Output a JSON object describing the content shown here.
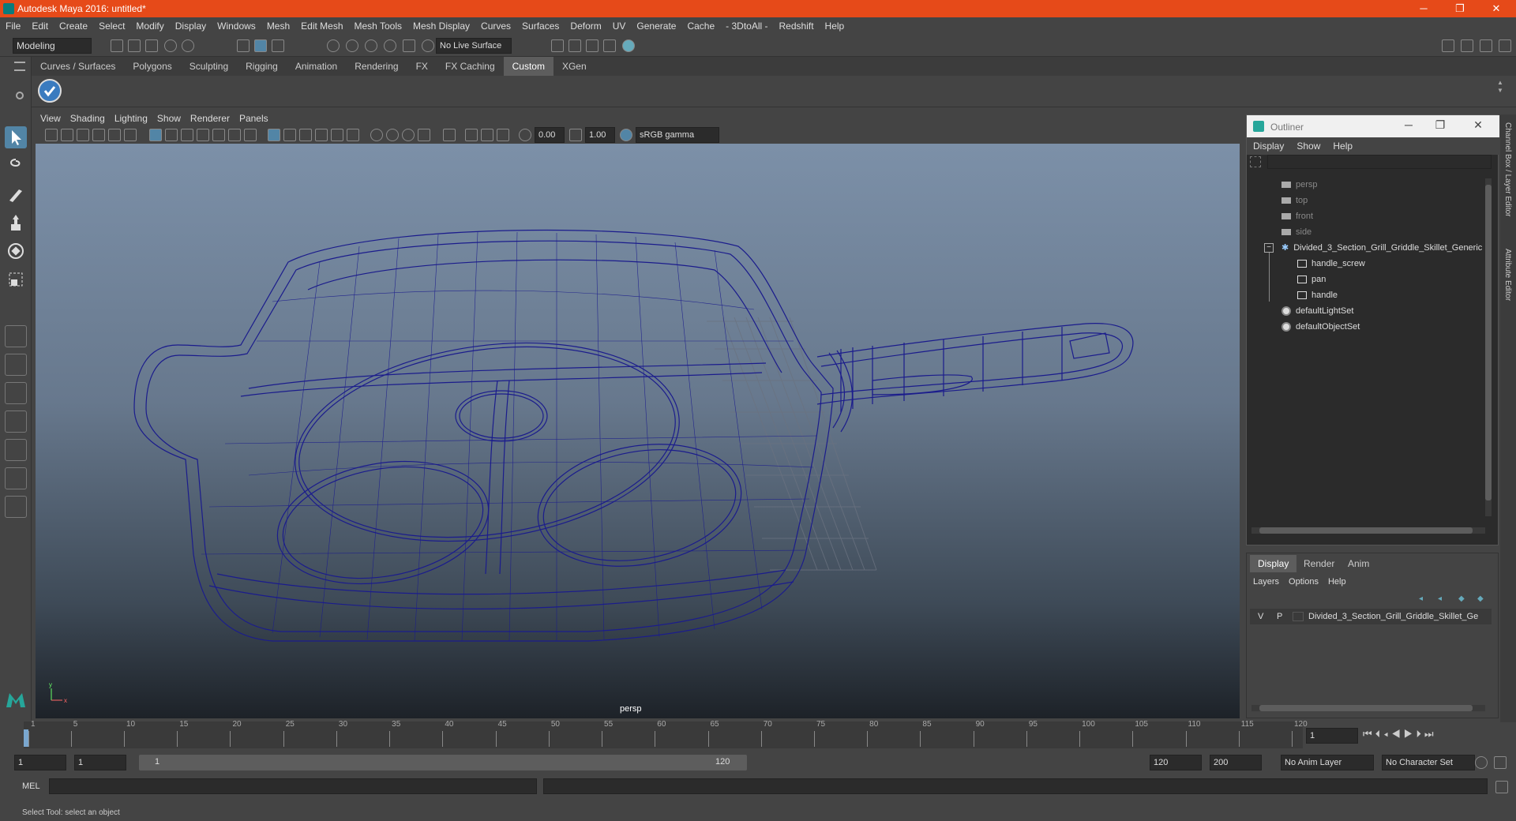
{
  "title": "Autodesk Maya 2016: untitled*",
  "window_controls": {
    "min": "─",
    "max": "❐",
    "close": "✕"
  },
  "menus": [
    "File",
    "Edit",
    "Create",
    "Select",
    "Modify",
    "Display",
    "Windows",
    "Mesh",
    "Edit Mesh",
    "Mesh Tools",
    "Mesh Display",
    "Curves",
    "Surfaces",
    "Deform",
    "UV",
    "Generate",
    "Cache",
    "- 3DtoAll -",
    "Redshift",
    "Help"
  ],
  "status": {
    "mode": "Modeling",
    "live_surface": "No Live Surface"
  },
  "shelf_tabs": [
    "Curves / Surfaces",
    "Polygons",
    "Sculpting",
    "Rigging",
    "Animation",
    "Rendering",
    "FX",
    "FX Caching",
    "Custom",
    "XGen"
  ],
  "active_shelf": "Custom",
  "viewport": {
    "menus": [
      "View",
      "Shading",
      "Lighting",
      "Show",
      "Renderer",
      "Panels"
    ],
    "exposure": "0.00",
    "gamma": "1.00",
    "color_space": "sRGB gamma",
    "camera_label": "persp"
  },
  "outliner": {
    "title": "Outliner",
    "menus": [
      "Display",
      "Show",
      "Help"
    ],
    "items": [
      {
        "label": "persp",
        "icon": "camera-icon",
        "dim": true
      },
      {
        "label": "top",
        "icon": "camera-icon",
        "dim": true
      },
      {
        "label": "front",
        "icon": "camera-icon",
        "dim": true
      },
      {
        "label": "side",
        "icon": "camera-icon",
        "dim": true
      },
      {
        "label": "Divided_3_Section_Grill_Griddle_Skillet_Generic",
        "icon": "group-icon"
      },
      {
        "label": "handle_screw",
        "icon": "mesh-icon"
      },
      {
        "label": "pan",
        "icon": "mesh-icon"
      },
      {
        "label": "handle",
        "icon": "mesh-icon"
      },
      {
        "label": "defaultLightSet",
        "icon": "set-icon"
      },
      {
        "label": "defaultObjectSet",
        "icon": "set-icon"
      }
    ]
  },
  "layer_editor": {
    "tabs": [
      "Display",
      "Render",
      "Anim"
    ],
    "active_tab": "Display",
    "menus": [
      "Layers",
      "Options",
      "Help"
    ],
    "layer": {
      "v": "V",
      "p": "P",
      "name": "Divided_3_Section_Grill_Griddle_Skillet_Ge"
    }
  },
  "side_tabs": [
    "Channel Box / Layer Editor",
    "Attribute Editor"
  ],
  "timeline": {
    "ticks": [
      "1",
      "5",
      "10",
      "15",
      "20",
      "25",
      "30",
      "35",
      "40",
      "45",
      "50",
      "55",
      "60",
      "65",
      "70",
      "75",
      "80",
      "85",
      "90",
      "95",
      "100",
      "105",
      "110",
      "115",
      "120"
    ],
    "current_frame": "1"
  },
  "range": {
    "start": "1",
    "playback_start": "1",
    "slider_start": "1",
    "slider_end": "120",
    "playback_end": "120",
    "end": "200",
    "anim_layer": "No Anim Layer",
    "character_set": "No Character Set"
  },
  "command_line": {
    "label": "MEL"
  },
  "help_line": "Select Tool: select an object",
  "colors": {
    "titlebar": "#e64a19",
    "wire": "#1b1c8c",
    "panel": "#444444",
    "field": "#2b2b2b"
  }
}
